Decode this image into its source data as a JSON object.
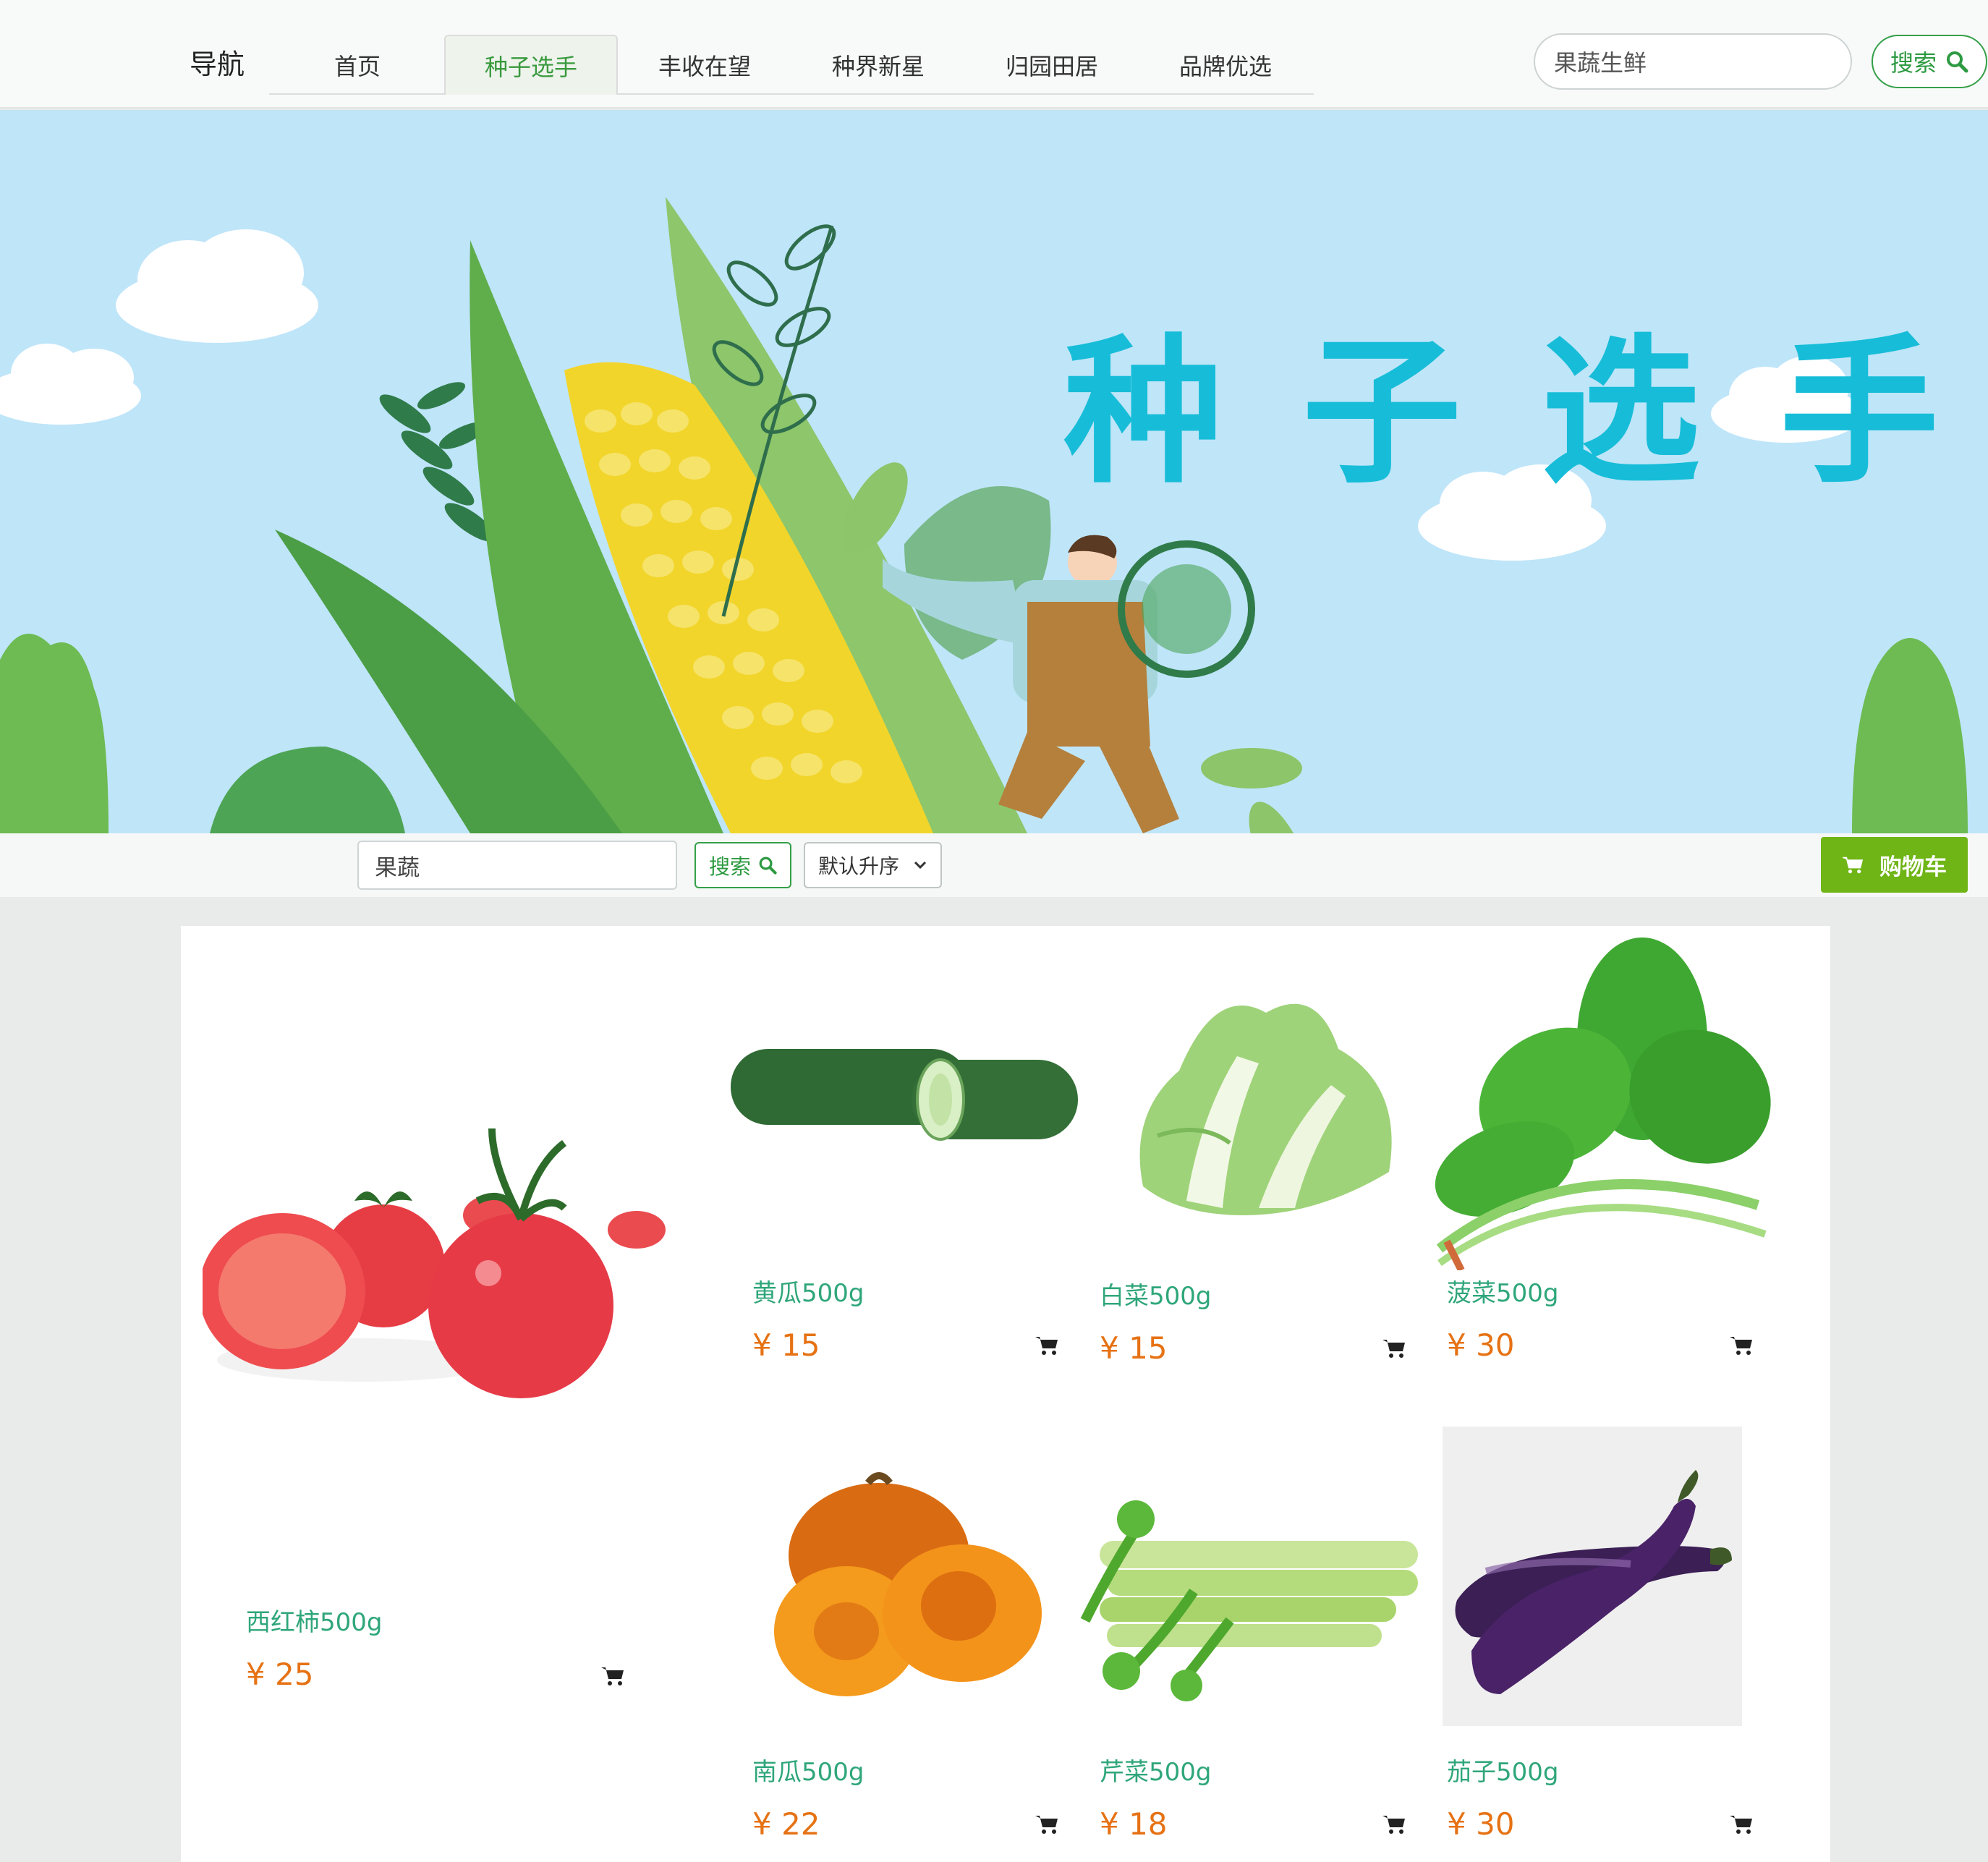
{
  "nav": {
    "brand": "导航",
    "items": [
      {
        "label": "首页"
      },
      {
        "label": "种子选手"
      },
      {
        "label": "丰收在望"
      },
      {
        "label": "种界新星"
      },
      {
        "label": "归园田居"
      },
      {
        "label": "品牌优选"
      }
    ],
    "active_index": 1,
    "search_value": "果蔬生鲜",
    "search_button": "搜索"
  },
  "banner": {
    "title": "种子选手"
  },
  "filter": {
    "search_value": "果蔬",
    "search_button": "搜索",
    "sort_selected": "默认升序",
    "cart_button": "购物车"
  },
  "products": [
    {
      "name": "西红柿500g",
      "price": "¥ 25",
      "image": "tomato"
    },
    {
      "name": "黄瓜500g",
      "price": "¥ 15",
      "image": "cucumber"
    },
    {
      "name": "白菜500g",
      "price": "¥ 15",
      "image": "cabbage"
    },
    {
      "name": "菠菜500g",
      "price": "¥ 30",
      "image": "spinach"
    },
    {
      "name": "南瓜500g",
      "price": "¥ 22",
      "image": "pumpkin"
    },
    {
      "name": "芹菜500g",
      "price": "¥ 18",
      "image": "celery"
    },
    {
      "name": "茄子500g",
      "price": "¥ 30",
      "image": "eggplant"
    }
  ],
  "colors": {
    "accent_green": "#34a048",
    "cart_green": "#6fb516",
    "product_name": "#2fa67a",
    "price_orange": "#e67214",
    "banner_sky": "#bfe5f9",
    "banner_title": "#17bdd8"
  },
  "icons": {
    "search": "magnifier-icon",
    "cart": "cart-icon",
    "dropdown": "chevron-down-icon"
  }
}
